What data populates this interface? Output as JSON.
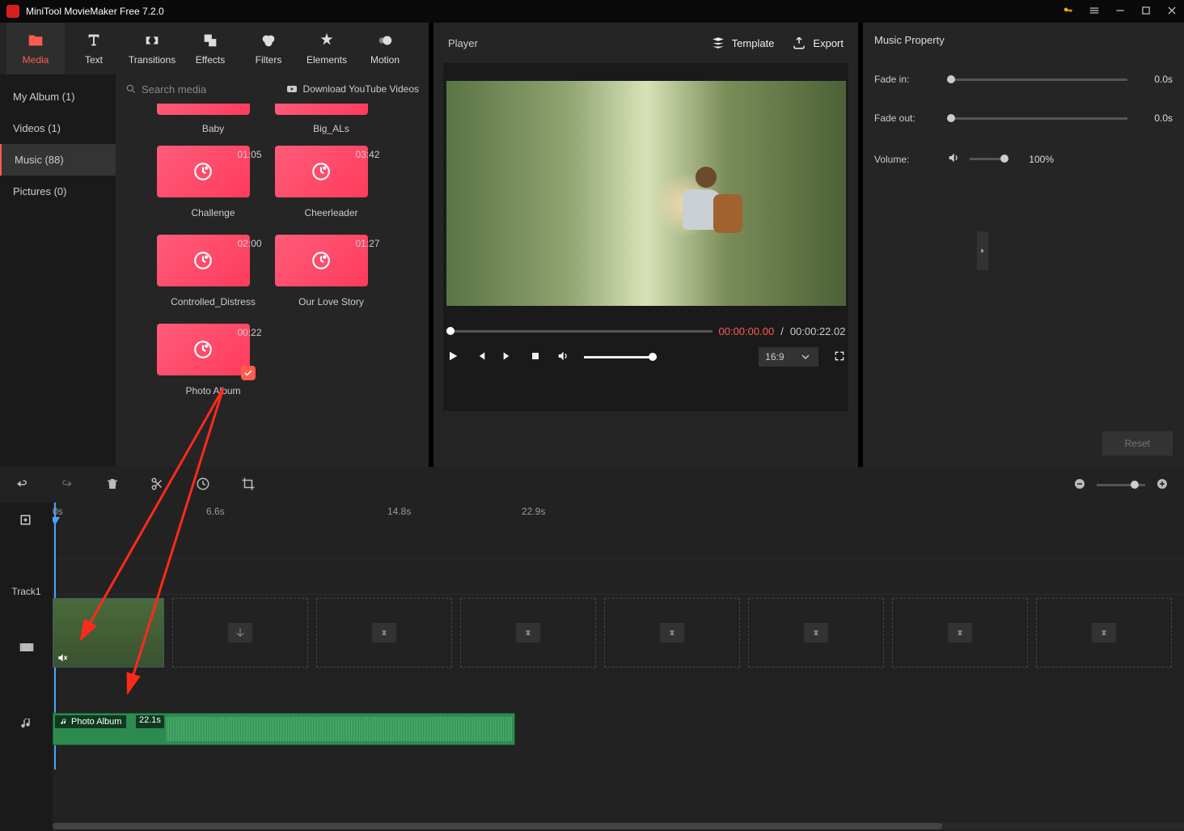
{
  "app": {
    "title": "MiniTool MovieMaker Free 7.2.0"
  },
  "tabs": [
    {
      "label": "Media",
      "icon": "folder"
    },
    {
      "label": "Text",
      "icon": "text"
    },
    {
      "label": "Transitions",
      "icon": "transitions"
    },
    {
      "label": "Effects",
      "icon": "effects"
    },
    {
      "label": "Filters",
      "icon": "filters"
    },
    {
      "label": "Elements",
      "icon": "elements"
    },
    {
      "label": "Motion",
      "icon": "motion"
    }
  ],
  "sidebar": {
    "items": [
      {
        "label": "My Album (1)"
      },
      {
        "label": "Videos (1)"
      },
      {
        "label": "Music (88)"
      },
      {
        "label": "Pictures (0)"
      }
    ]
  },
  "library": {
    "search_placeholder": "Search media",
    "download_label": "Download YouTube Videos",
    "row0": [
      {
        "name": "Baby"
      },
      {
        "name": "Big_ALs"
      }
    ],
    "cards": [
      {
        "name": "Challenge",
        "dur": "01:05"
      },
      {
        "name": "Cheerleader",
        "dur": "03:42"
      },
      {
        "name": "Controlled_Distress",
        "dur": "02:00"
      },
      {
        "name": "Our Love Story",
        "dur": "01:27"
      },
      {
        "name": "Photo Album",
        "dur": "00:22",
        "selected": true
      }
    ]
  },
  "player": {
    "label": "Player",
    "template_label": "Template",
    "export_label": "Export",
    "time_current": "00:00:00.00",
    "time_divider": "/",
    "time_total": "00:00:22.02",
    "aspect": "16:9"
  },
  "props": {
    "title": "Music Property",
    "fade_in_label": "Fade in:",
    "fade_in_value": "0.0s",
    "fade_out_label": "Fade out:",
    "fade_out_value": "0.0s",
    "volume_label": "Volume:",
    "volume_value": "100%",
    "reset_label": "Reset"
  },
  "timeline": {
    "marks": [
      "0s",
      "6.6s",
      "14.8s",
      "22.9s"
    ],
    "track_label": "Track1",
    "audio_clip_name": "Photo Album",
    "audio_clip_dur": "22.1s"
  }
}
